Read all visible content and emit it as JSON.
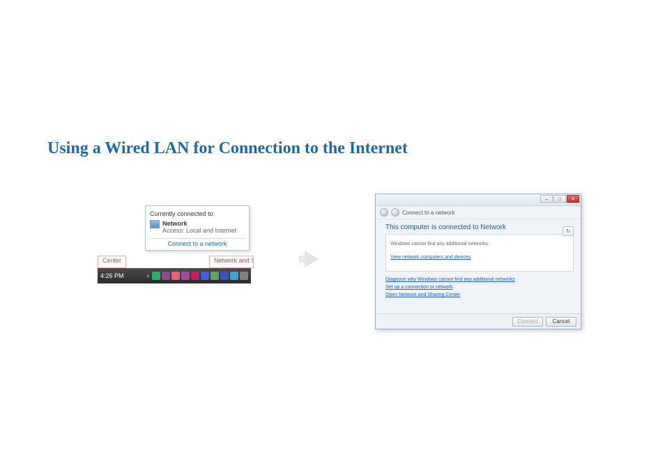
{
  "page": {
    "title": "Using a Wired LAN for Connection to the Internet"
  },
  "tray_popup": {
    "header": "Currently connected to:",
    "network_name": "Network",
    "access_label": "Access:  Local and Internet",
    "connect_link": "Connect to a network"
  },
  "tooltip_left": "Center",
  "tooltip_right": "Network and Shar",
  "taskbar": {
    "clock": "4:26 PM"
  },
  "dialog": {
    "crumb_title": "Connect to a network",
    "heading": "This computer is connected to Network",
    "refresh_icon": "↻",
    "no_networks_msg": "Windows cannot find any additional networks.",
    "link_view_computers": "View network computers and devices",
    "link_diagnose": "Diagnose why Windows cannot find any additional networks",
    "link_setup": "Set up a connection or network",
    "link_open_center": "Open Network and Sharing Center",
    "btn_connect": "Connect",
    "btn_cancel": "Cancel",
    "win_min": "–",
    "win_max": "□",
    "win_close": "✕"
  }
}
